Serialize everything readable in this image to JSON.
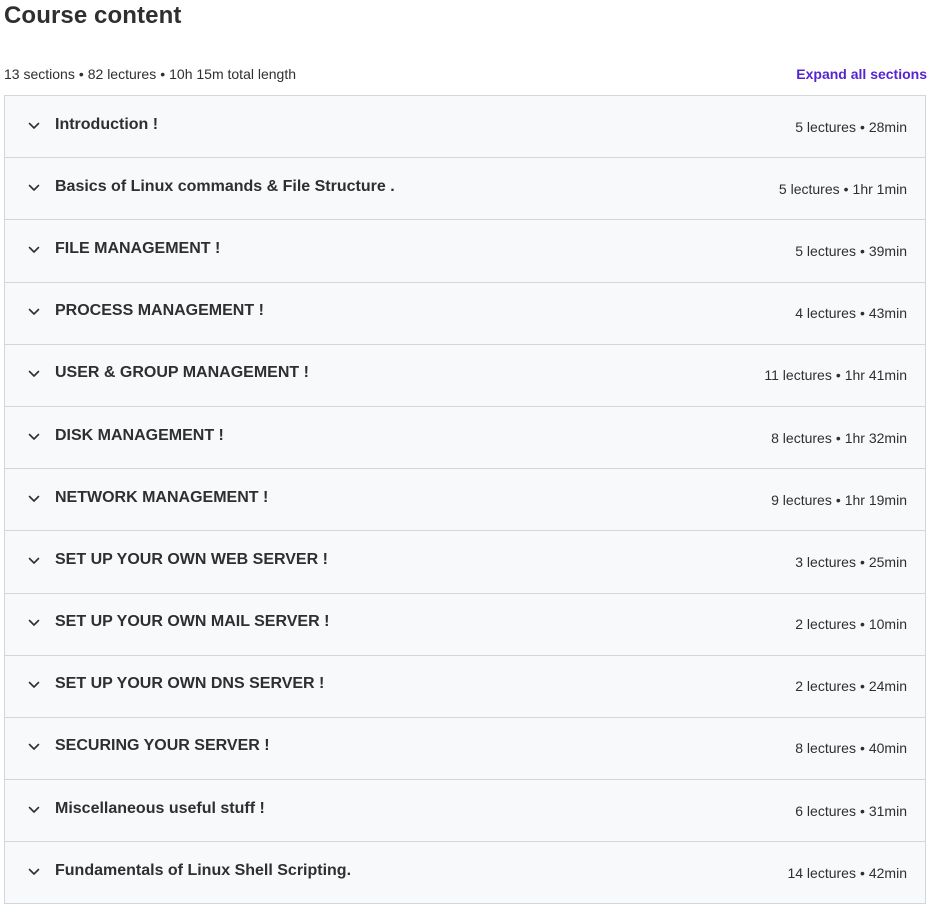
{
  "header": {
    "title": "Course content",
    "summary_sections": "13 sections",
    "summary_lectures": "82 lectures",
    "summary_length": "10h 15m total length",
    "expand_all_label": "Expand all sections",
    "accent_color": "#5624d0"
  },
  "icons": {
    "section_toggle": "chevron-down-icon"
  },
  "sections": [
    {
      "title": "Introduction !",
      "lectures": "5 lectures",
      "duration": "28min"
    },
    {
      "title": "Basics of Linux commands & File Structure .",
      "lectures": "5 lectures",
      "duration": "1hr 1min"
    },
    {
      "title": "FILE MANAGEMENT !",
      "lectures": "5 lectures",
      "duration": "39min"
    },
    {
      "title": "PROCESS MANAGEMENT !",
      "lectures": "4 lectures",
      "duration": "43min"
    },
    {
      "title": "USER & GROUP MANAGEMENT !",
      "lectures": "11 lectures",
      "duration": "1hr 41min"
    },
    {
      "title": "DISK MANAGEMENT !",
      "lectures": "8 lectures",
      "duration": "1hr 32min"
    },
    {
      "title": "NETWORK MANAGEMENT !",
      "lectures": "9 lectures",
      "duration": "1hr 19min"
    },
    {
      "title": "SET UP YOUR OWN WEB SERVER !",
      "lectures": "3 lectures",
      "duration": "25min"
    },
    {
      "title": "SET UP YOUR OWN MAIL SERVER !",
      "lectures": "2 lectures",
      "duration": "10min"
    },
    {
      "title": "SET UP YOUR OWN DNS SERVER !",
      "lectures": "2 lectures",
      "duration": "24min"
    },
    {
      "title": "SECURING YOUR SERVER !",
      "lectures": "8 lectures",
      "duration": "40min"
    },
    {
      "title": "Miscellaneous useful stuff !",
      "lectures": "6 lectures",
      "duration": "31min"
    },
    {
      "title": "Fundamentals of Linux Shell Scripting.",
      "lectures": "14 lectures",
      "duration": "42min"
    }
  ]
}
